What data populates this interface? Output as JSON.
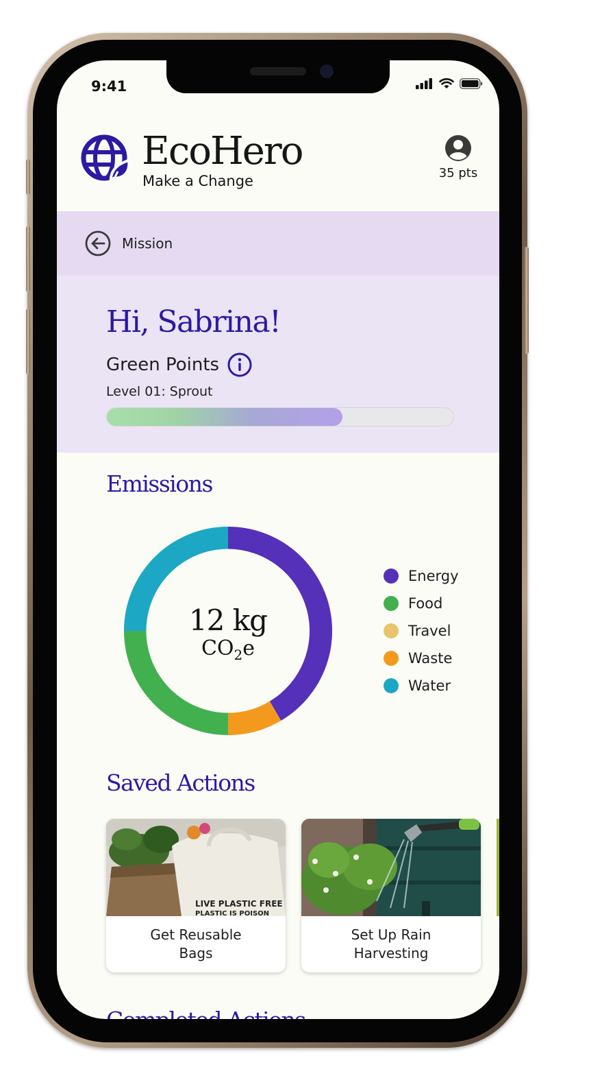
{
  "status_bar": {
    "time": "9:41"
  },
  "header": {
    "brand": "EcoHero",
    "tagline": "Make a Change",
    "points": "35 pts"
  },
  "mission_bar": {
    "label": "Mission"
  },
  "greeting": {
    "title": "Hi, Sabrina!",
    "points_label": "Green Points",
    "level": "Level 01: Sprout",
    "progress": 0.68
  },
  "emissions": {
    "title": "Emissions",
    "value": "12 kg",
    "unit_main": "CO",
    "unit_sub": "2",
    "unit_tail": "e",
    "legend": [
      {
        "label": "Energy",
        "color": "#5530b8"
      },
      {
        "label": "Food",
        "color": "#43b050"
      },
      {
        "label": "Travel",
        "color": "#e9c46d"
      },
      {
        "label": "Waste",
        "color": "#f39a1e"
      },
      {
        "label": "Water",
        "color": "#1ca7c4"
      }
    ]
  },
  "saved_actions": {
    "title": "Saved Actions",
    "cards": [
      {
        "label": "Get Reusable Bags",
        "bag_text": "LIVE PLASTIC FREE PLASTIC IS POISON"
      },
      {
        "label": "Set Up Rain Harvesting"
      }
    ]
  },
  "completed_actions": {
    "title": "Completed Actions"
  },
  "colors": {
    "accent": "#2c1aa3",
    "mission_bg": "#e6daf2",
    "greeting_bg": "#ebe4f5",
    "screen_bg": "#fbfcf6"
  }
}
